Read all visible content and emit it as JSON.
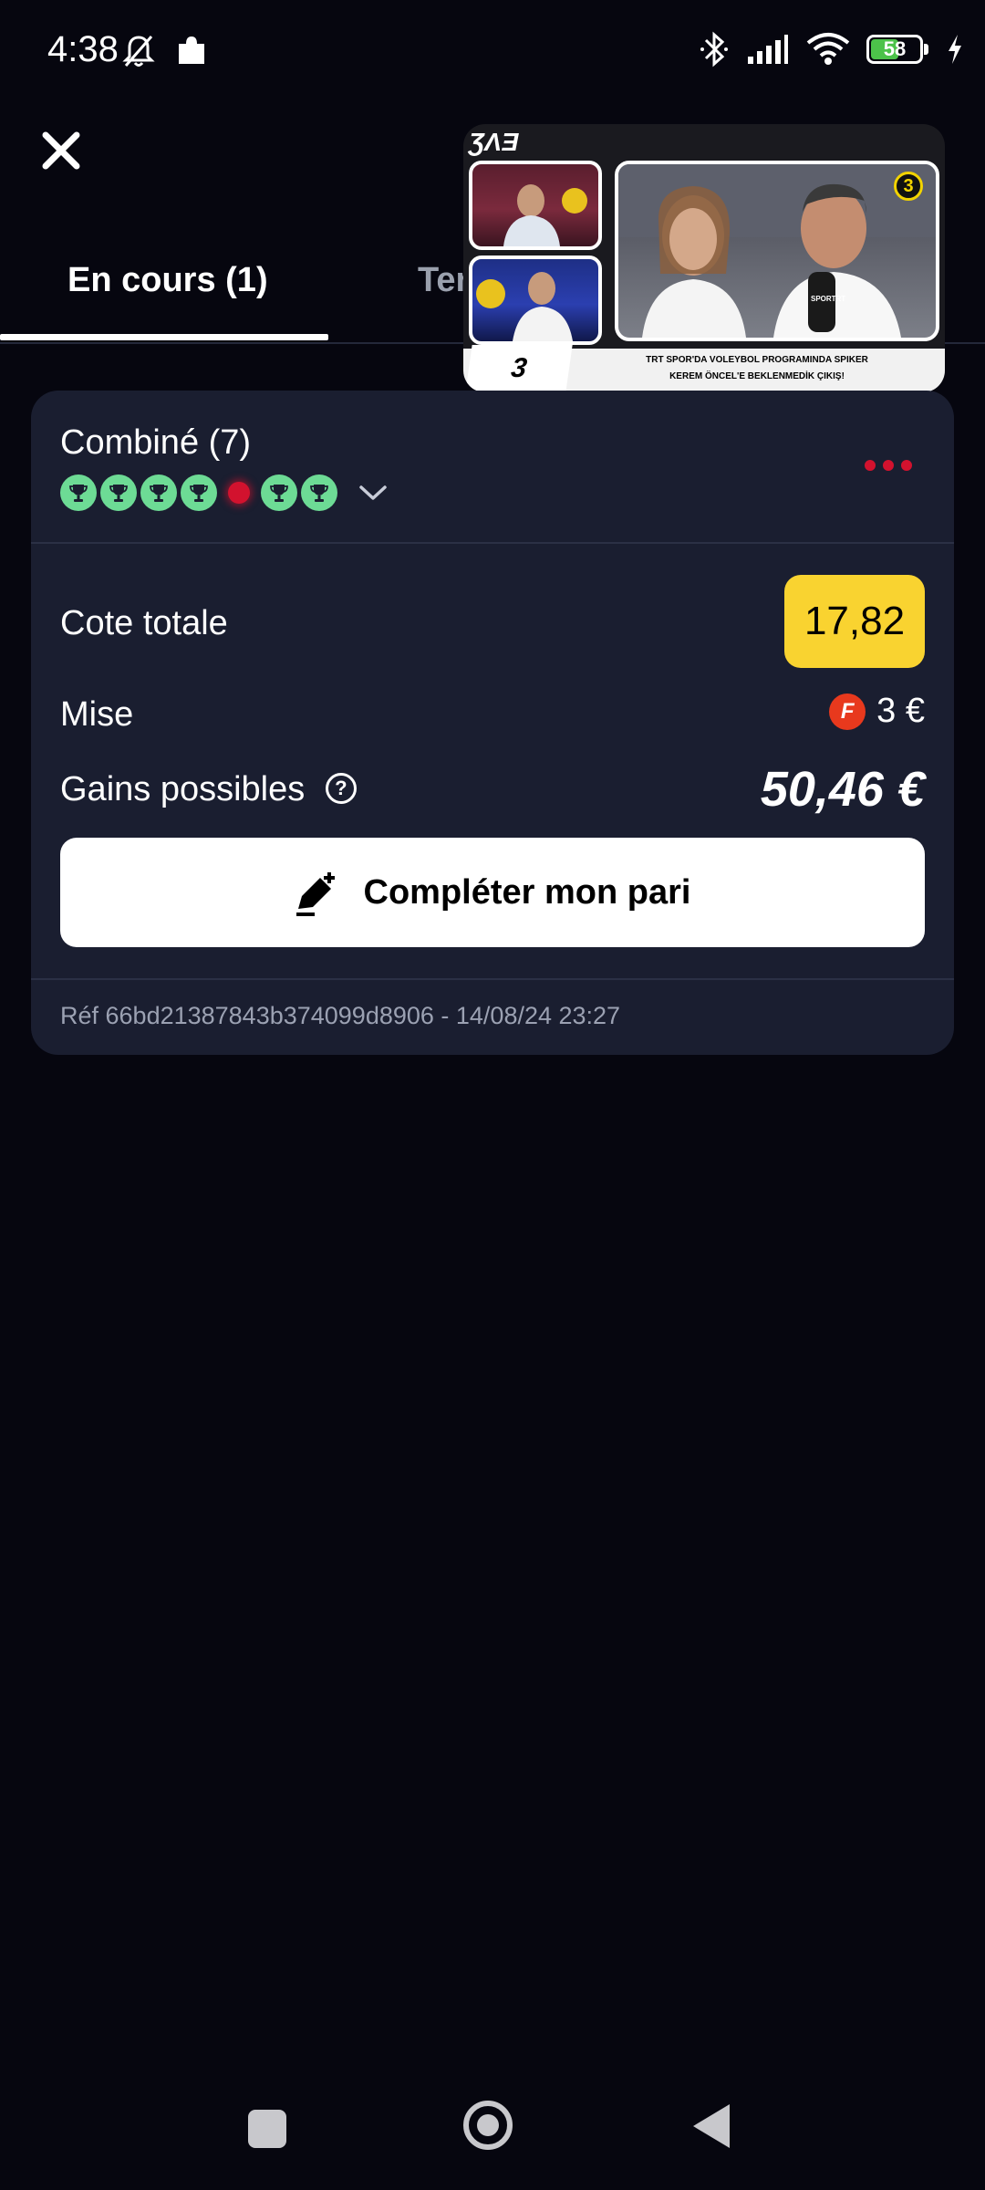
{
  "status_bar": {
    "time": "4:38",
    "battery_level": "58",
    "battery_fraction": 0.58,
    "icons": [
      "notifications-off-icon",
      "puzzle-icon",
      "bluetooth-icon",
      "signal-icon",
      "wifi-icon",
      "battery-icon",
      "charging-icon"
    ]
  },
  "header": {
    "close_icon": "close-icon"
  },
  "tabs": [
    {
      "label": "En cours (1)",
      "active": true
    },
    {
      "label": "Ter",
      "active": false
    }
  ],
  "pip": {
    "logo": "ƷɅƎ",
    "badge": "3",
    "banner_number": "3",
    "banner_line1": "TRT SPOR'DA VOLEYBOL PROGRAMINDA SPIKER",
    "banner_line2": "KEREM ÖNCEL'E BEKLENMEDİK ÇIKIŞ!",
    "mic_text": "SPORTRT"
  },
  "bet": {
    "title": "Combiné (7)",
    "legs": [
      "won",
      "won",
      "won",
      "won",
      "lost",
      "won",
      "won"
    ],
    "total_odds_label": "Cote totale",
    "total_odds": "17,82",
    "stake_label": "Mise",
    "stake_badge": "F",
    "stake_value": "3 €",
    "gains_label": "Gains possibles",
    "gains_value": "50,46 €",
    "complete_button": "Compléter mon pari",
    "reference": "Réf 66bd21387843b374099d8906 - 14/08/24 23:27"
  },
  "colors": {
    "background": "#06060f",
    "card": "#1a1e30",
    "odds_badge": "#f9d330",
    "leg_won": "#6ddb95",
    "leg_lost": "#d2122e",
    "accent_red": "#d2122e"
  }
}
